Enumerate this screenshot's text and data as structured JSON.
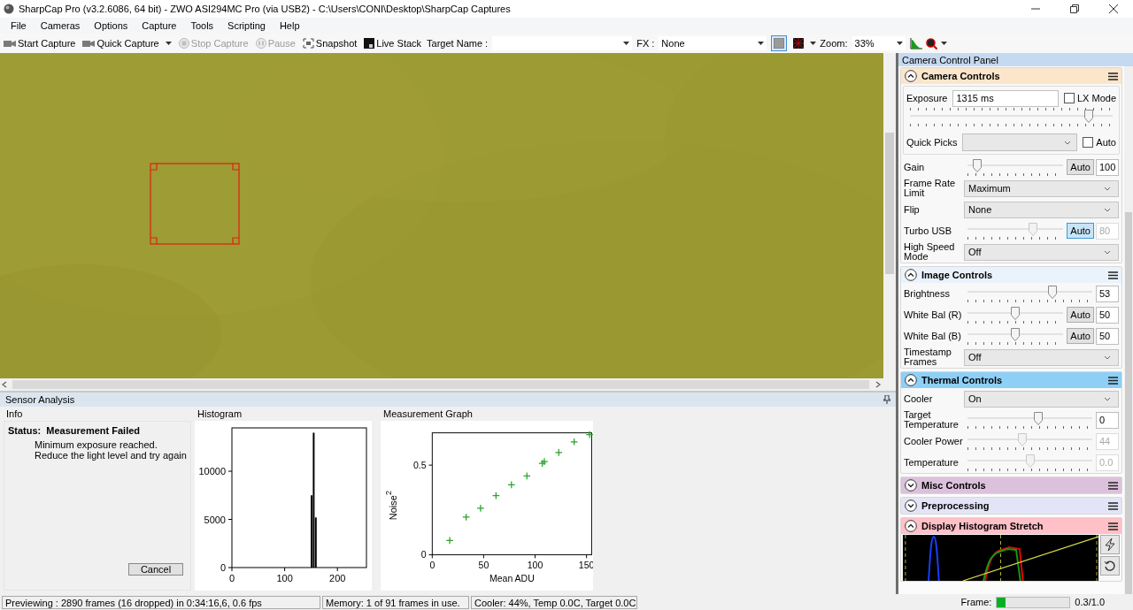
{
  "window": {
    "title": "SharpCap Pro (v3.2.6086, 64 bit) - ZWO ASI294MC Pro (via USB2) - C:\\Users\\CONI\\Desktop\\SharpCap Captures"
  },
  "menu": [
    "File",
    "Cameras",
    "Options",
    "Capture",
    "Tools",
    "Scripting",
    "Help"
  ],
  "toolbar": {
    "buttons": [
      {
        "kind": "camera",
        "label": "Start Capture",
        "disabled": false
      },
      {
        "kind": "camera-menu",
        "label": "Quick Capture",
        "disabled": false
      },
      {
        "kind": "stop",
        "label": "Stop Capture",
        "disabled": true
      },
      {
        "kind": "pause",
        "label": "Pause",
        "disabled": true
      },
      {
        "kind": "snapshot",
        "label": "Snapshot",
        "disabled": false
      },
      {
        "kind": "stack",
        "label": "Live Stack",
        "disabled": false
      }
    ],
    "target_label": "Target Name :",
    "fx_label": "FX :",
    "fx_value": "None",
    "display_modes": [
      {
        "selected": true
      },
      {
        "selected": false
      }
    ],
    "zoom_label": "Zoom:",
    "zoom_value": "33%"
  },
  "sensor_analysis": {
    "title": "Sensor Analysis",
    "info": {
      "title": "Info",
      "status_label": "Status:",
      "status": "Measurement Failed",
      "message": "Minimum exposure reached. Reduce the light level and try again",
      "button": "Cancel"
    },
    "histogram": {
      "title": "Histogram",
      "chart_data": {
        "type": "bar",
        "x": [
          151,
          155,
          159
        ],
        "values": [
          7500,
          14000,
          5200
        ],
        "xlim": [
          0,
          255
        ],
        "ylim": [
          0,
          14500
        ],
        "xticks": [
          0,
          100,
          200
        ],
        "yticks": [
          0,
          5000,
          10000
        ]
      }
    },
    "measurement": {
      "title": "Measurement Graph",
      "chart_data": {
        "type": "scatter",
        "xlabel": "Mean ADU",
        "ylabel": "Noise$^{2}$",
        "x": [
          17,
          33,
          47,
          62,
          77,
          92,
          107,
          109,
          123,
          138,
          153
        ],
        "series": [
          {
            "color": "#2ca02c",
            "values": [
              0.08,
              0.21,
              0.26,
              0.33,
              0.39,
              0.44,
              0.51,
              0.52,
              0.57,
              0.63,
              0.67
            ]
          }
        ],
        "xlim": [
          0,
          155
        ],
        "ylim": [
          0,
          0.68
        ],
        "xticks": [
          0,
          50,
          100,
          150
        ],
        "yticks": [
          0,
          0.5
        ]
      }
    }
  },
  "control_panel": {
    "title": "Camera Control Panel",
    "sections": [
      {
        "title": "Camera Controls",
        "color": "#fbe6cc",
        "expanded": true,
        "rows": [
          {
            "kind": "exposure",
            "label": "Exposure",
            "value": "1315 ms",
            "checkbox": {
              "label": "LX Mode",
              "checked": false
            },
            "level": 0.88,
            "picks_label": "Quick Picks",
            "picks_checkbox": {
              "label": "Auto",
              "checked": false
            }
          },
          {
            "kind": "slider",
            "label": "Gain",
            "level": 0.1,
            "auto": {
              "label": "Auto",
              "selected": false
            },
            "value": "100",
            "disabled": false
          },
          {
            "kind": "select",
            "label": "Frame Rate Limit",
            "value": "Maximum"
          },
          {
            "kind": "select",
            "label": "Flip",
            "value": "None"
          },
          {
            "kind": "slider",
            "label": "Turbo USB",
            "level": 0.68,
            "auto": {
              "label": "Auto",
              "selected": true
            },
            "value": "80",
            "disabled": true
          },
          {
            "kind": "select",
            "label": "High Speed Mode",
            "value": "Off"
          }
        ]
      },
      {
        "title": "Image Controls",
        "color": "#eaf3fc",
        "expanded": true,
        "rows": [
          {
            "kind": "slider",
            "label": "Brightness",
            "level": 0.68,
            "value": "53",
            "disabled": false
          },
          {
            "kind": "slider",
            "label": "White Bal (R)",
            "level": 0.5,
            "auto": {
              "label": "Auto",
              "selected": false
            },
            "value": "50",
            "disabled": false
          },
          {
            "kind": "slider",
            "label": "White Bal (B)",
            "level": 0.5,
            "auto": {
              "label": "Auto",
              "selected": false
            },
            "value": "50",
            "disabled": false
          },
          {
            "kind": "select",
            "label": "Timestamp Frames",
            "value": "Off"
          }
        ]
      },
      {
        "title": "Thermal Controls",
        "color": "#8ecff6",
        "expanded": true,
        "rows": [
          {
            "kind": "select",
            "label": "Cooler",
            "value": "On"
          },
          {
            "kind": "slider",
            "label": "Target Temperature",
            "level": 0.57,
            "value": "0",
            "disabled": false
          },
          {
            "kind": "slider",
            "label": "Cooler Power",
            "level": 0.44,
            "value": "44",
            "disabled": true
          },
          {
            "kind": "slider",
            "label": "Temperature",
            "level": 0.5,
            "value": "0.0",
            "disabled": true
          }
        ]
      },
      {
        "title": "Misc Controls",
        "color": "#dcc1dc",
        "expanded": false
      },
      {
        "title": "Preprocessing",
        "color": "#e4e4f8",
        "expanded": false
      },
      {
        "title": "Display Histogram Stretch",
        "color": "#ffc0c8",
        "expanded": true,
        "rows": [
          {
            "kind": "stretch"
          }
        ]
      }
    ]
  },
  "status_bar": {
    "previewing": "Previewing : 2890 frames (16 dropped) in 0:34:16,6, 0.6 fps",
    "memory": "Memory: 1 of 91 frames in use.",
    "cooler": "Cooler: 44%, Temp 0.0C, Target 0.0C",
    "frame": {
      "label": "Frame:",
      "level": 0.12,
      "reading": "0.3/1.0"
    }
  }
}
